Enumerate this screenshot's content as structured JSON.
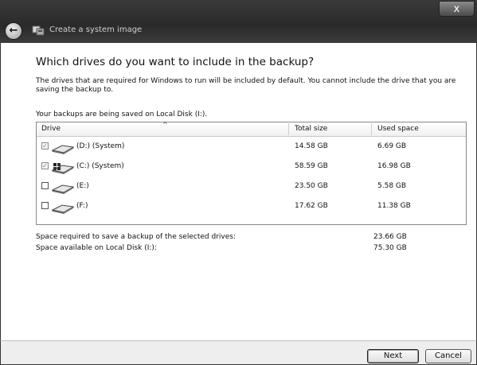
{
  "window": {
    "title": "Create a system image",
    "close_glyph": "x",
    "back_glyph": "←",
    "app_icon": "backup-icon"
  },
  "page": {
    "heading": "Which drives do you want to include in the backup?",
    "description": "The drives that are required for Windows to run will be included by default. You cannot include the drive that you are saving the backup to.",
    "saving_to": "Your backups are being saved on Local Disk (I:)."
  },
  "table": {
    "columns": {
      "drive": "Drive",
      "total": "Total size",
      "used": "Used space"
    },
    "sort_glyph": "^",
    "rows": [
      {
        "name": "(D:) (System)",
        "total": "14.58 GB",
        "used": "6.69 GB",
        "checked": true,
        "disabled": true,
        "icon": "hard-drive-icon"
      },
      {
        "name": "(C:) (System)",
        "total": "58.59 GB",
        "used": "16.98 GB",
        "checked": true,
        "disabled": true,
        "icon": "windows-drive-icon"
      },
      {
        "name": "(E:)",
        "total": "23.50 GB",
        "used": "5.58 GB",
        "checked": false,
        "disabled": false,
        "icon": "hard-drive-icon"
      },
      {
        "name": "(F:)",
        "total": "17.62 GB",
        "used": "11.38 GB",
        "checked": false,
        "disabled": false,
        "icon": "hard-drive-icon"
      }
    ]
  },
  "summary": {
    "required_label": "Space required to save a backup of the selected drives:",
    "required_value": "23.66 GB",
    "available_label": "Space available on Local Disk (I:):",
    "available_value": "75.30 GB"
  },
  "buttons": {
    "next": "Next",
    "cancel": "Cancel"
  }
}
